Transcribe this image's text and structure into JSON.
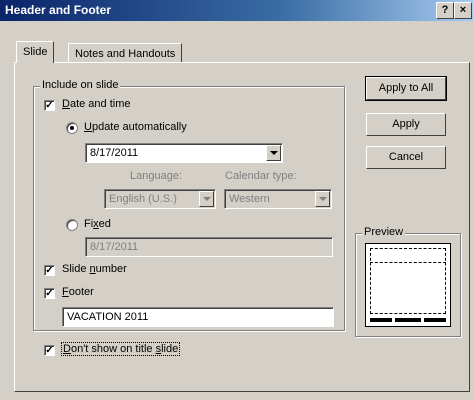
{
  "window": {
    "title": "Header and Footer",
    "help_button": "?",
    "close_button": "×"
  },
  "tabs": [
    {
      "label": "Slide",
      "active": true
    },
    {
      "label": "Notes and Handouts",
      "active": false
    }
  ],
  "include_group": {
    "label": "Include on slide",
    "date_time": {
      "label": "Date and time",
      "checked": true
    },
    "update_auto": {
      "label": "Update automatically",
      "selected": true
    },
    "date_value": "8/17/2011",
    "language_label": "Language:",
    "language_value": "English (U.S.)",
    "calendar_label": "Calendar type:",
    "calendar_value": "Western",
    "fixed": {
      "label": "Fixed",
      "selected": false
    },
    "fixed_value": "8/17/2011",
    "slide_number": {
      "label": "Slide number",
      "checked": true
    },
    "footer": {
      "label": "Footer",
      "checked": true
    },
    "footer_value": "VACATION 2011"
  },
  "dont_show_title": {
    "label": "Don't show on title slide",
    "checked": true
  },
  "buttons": {
    "apply_all": "Apply to All",
    "apply": "Apply",
    "cancel": "Cancel"
  },
  "preview": {
    "label": "Preview"
  }
}
